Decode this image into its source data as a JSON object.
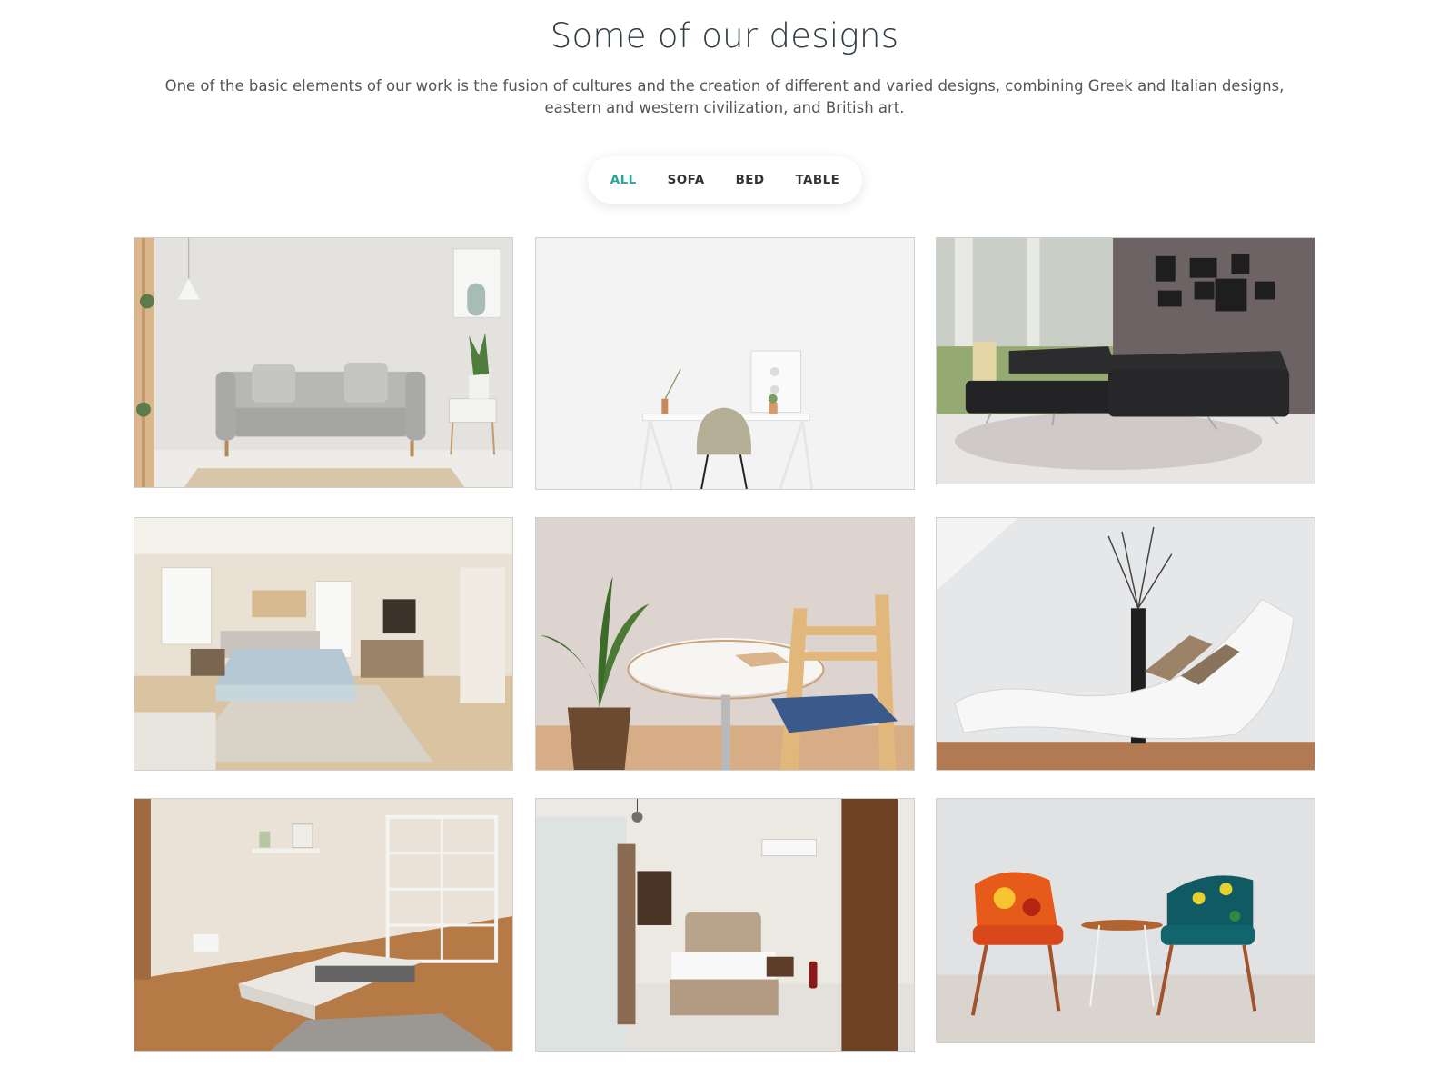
{
  "section": {
    "title": "Some of our designs",
    "description": "One of the basic elements of our work is the fusion of cultures and the creation of different and varied designs, combining Greek and Italian designs, eastern and western civilization, and British art."
  },
  "filters": {
    "items": [
      "ALL",
      "SOFA",
      "BED",
      "TABLE"
    ],
    "active": "ALL",
    "active_color": "#27a596"
  },
  "gallery": {
    "images": [
      {
        "subject": "grey sofa in living room"
      },
      {
        "subject": "white desk with chair"
      },
      {
        "subject": "black leather corner sofa"
      },
      {
        "subject": "bedroom with dresser"
      },
      {
        "subject": "round table with wooden chair"
      },
      {
        "subject": "white chaise lounge"
      },
      {
        "subject": "bedroom with shelves"
      },
      {
        "subject": "hotel bedroom"
      },
      {
        "subject": "two patterned armchairs"
      }
    ]
  }
}
